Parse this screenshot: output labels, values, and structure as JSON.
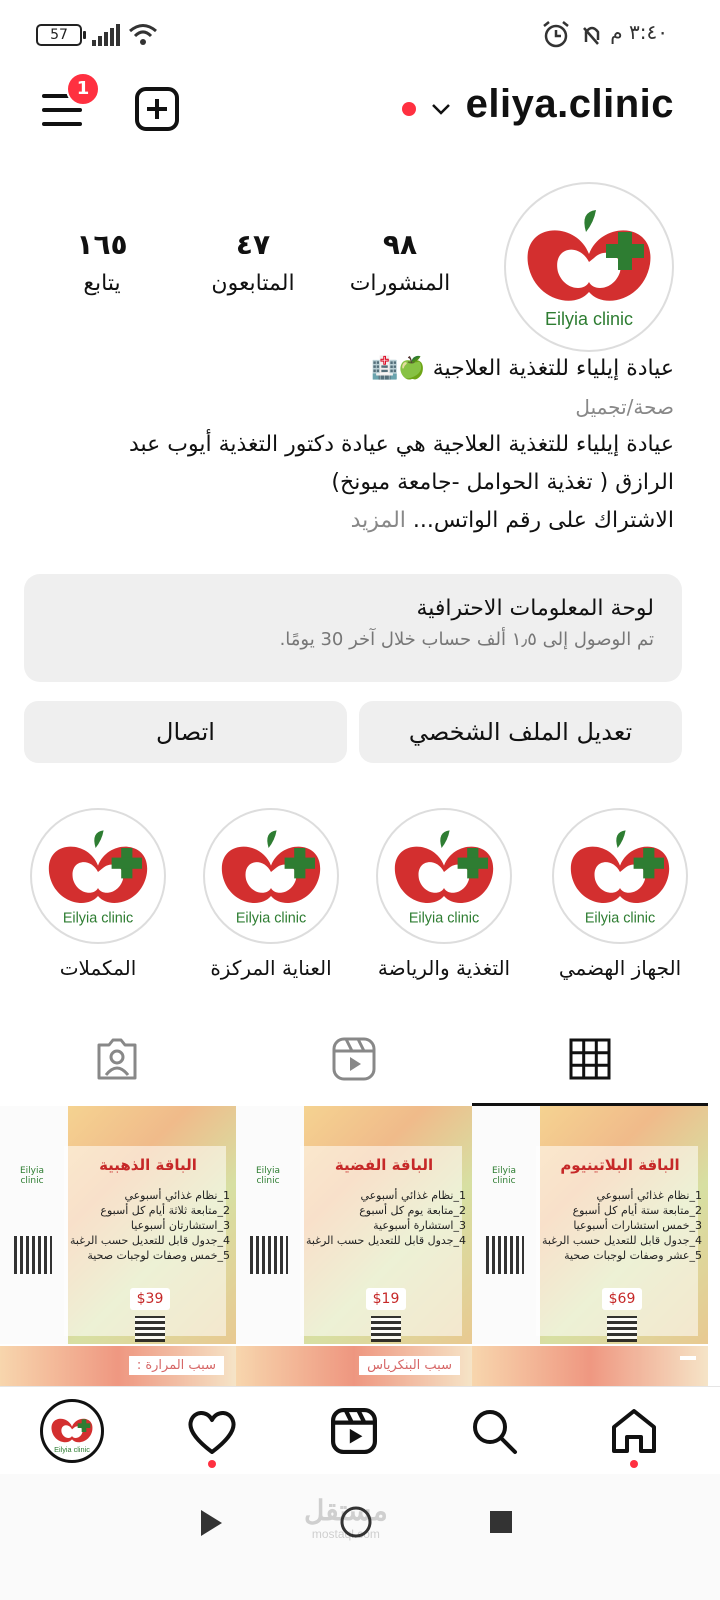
{
  "status_bar": {
    "battery": "57",
    "time": "٣:٤٠ م"
  },
  "header": {
    "username": "eliya.clinic",
    "notification_count": "1"
  },
  "profile": {
    "logo_text": "Eilyia clinic",
    "stats": [
      {
        "num": "٩٨",
        "label": "المنشورات"
      },
      {
        "num": "٤٧",
        "label": "المتابعون"
      },
      {
        "num": "١٦٥",
        "label": "يتابع"
      }
    ],
    "bio": {
      "name": "عيادة إيلياء للتغذية العلاجية 🍏🏥",
      "category": "صحة/تجميل",
      "line1": "عيادة إيلياء للتغذية العلاجية هي عيادة دكتور التغذية أيوب عبد",
      "line2": "الرازق  ( تغذية الحوامل -جامعة ميونخ)",
      "line3": "الاشتراك على رقم الواتس...",
      "more": "المزيد"
    }
  },
  "dashboard": {
    "title": "لوحة المعلومات الاحترافية",
    "subtitle": "تم الوصول إلى ١٫٥ ألف حساب خلال آخر 30 يومًا."
  },
  "buttons": {
    "edit_profile": "تعديل الملف الشخصي",
    "contact": "اتصال"
  },
  "highlights": [
    {
      "label": "الجهاز الهضمي",
      "logo": "Eilyia clinic"
    },
    {
      "label": "التغذية والرياضة",
      "logo": "Eilyia clinic"
    },
    {
      "label": "العناية المركزة",
      "logo": "Eilyia clinic"
    },
    {
      "label": "المكملات",
      "logo": "Eilyia clinic"
    }
  ],
  "posts": [
    {
      "title": "الباقة البلاتينيوم",
      "lines": [
        "1_نظام غذائي أسبوعي",
        "2_متابعة ستة أيام كل أسبوع",
        "3_خمس استشارات أسبوعيا",
        "4_جدول قابل للتعديل حسب الرغبة",
        "5_عشر وصفات لوجبات صحية"
      ],
      "price": "$69",
      "logo": "Eilyia clinic"
    },
    {
      "title": "الباقة الفضية",
      "lines": [
        "1_نظام غذائي أسبوعي",
        "2_متابعة يوم كل أسبوع",
        "3_استشارة أسبوعية",
        "4_جدول قابل للتعديل حسب الرغبة"
      ],
      "price": "$19",
      "logo": "Eilyia clinic"
    },
    {
      "title": "الباقة الذهبية",
      "lines": [
        "1_نظام غذائي أسبوعي",
        "2_متابعة ثلاثة أيام كل أسبوع",
        "3_استشارتان أسبوعيا",
        "4_جدول قابل للتعديل حسب الرغبة",
        "5_خمس وصفات لوجبات صحية"
      ],
      "price": "$39",
      "logo": "Eilyia clinic"
    }
  ],
  "posts_row2": [
    {
      "caption": ""
    },
    {
      "caption": "سبب البنكرياس"
    },
    {
      "caption": "سبب المرارة :"
    }
  ],
  "bottom_nav": {
    "profile_logo": "Eilyia clinic"
  },
  "system": {
    "watermark": "مستقل",
    "watermark_sub": "mostaql.com"
  },
  "colors": {
    "accent_red": "#ff3040",
    "brand_red": "#d32f2f",
    "brand_green": "#2e7d32"
  }
}
